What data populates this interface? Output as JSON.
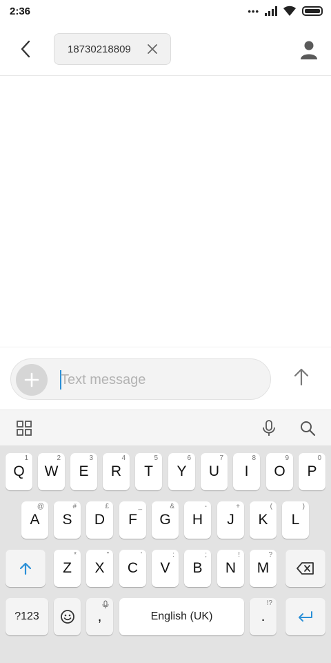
{
  "status": {
    "time": "2:36",
    "dots": "•••"
  },
  "header": {
    "recipient": "18730218809"
  },
  "composer": {
    "placeholder": "Text message"
  },
  "keyboard": {
    "row1": [
      {
        "label": "Q",
        "hint": "1"
      },
      {
        "label": "W",
        "hint": "2"
      },
      {
        "label": "E",
        "hint": "3"
      },
      {
        "label": "R",
        "hint": "4"
      },
      {
        "label": "T",
        "hint": "5"
      },
      {
        "label": "Y",
        "hint": "6"
      },
      {
        "label": "U",
        "hint": "7"
      },
      {
        "label": "I",
        "hint": "8"
      },
      {
        "label": "O",
        "hint": "9"
      },
      {
        "label": "P",
        "hint": "0"
      }
    ],
    "row2": [
      {
        "label": "A",
        "hint": "@"
      },
      {
        "label": "S",
        "hint": "#"
      },
      {
        "label": "D",
        "hint": "£"
      },
      {
        "label": "F",
        "hint": "_"
      },
      {
        "label": "G",
        "hint": "&"
      },
      {
        "label": "H",
        "hint": "-"
      },
      {
        "label": "J",
        "hint": "+"
      },
      {
        "label": "K",
        "hint": "("
      },
      {
        "label": "L",
        "hint": ")"
      }
    ],
    "row3": [
      {
        "label": "Z",
        "hint": "*"
      },
      {
        "label": "X",
        "hint": "\""
      },
      {
        "label": "C",
        "hint": "'"
      },
      {
        "label": "V",
        "hint": ":"
      },
      {
        "label": "B",
        "hint": ";"
      },
      {
        "label": "N",
        "hint": "!"
      },
      {
        "label": "M",
        "hint": "?"
      }
    ],
    "symbols_label": "?123",
    "comma_label": ",",
    "space_label": "English (UK)",
    "period_label": ".",
    "period_hint": "!?"
  },
  "colors": {
    "accent": "#2a8fd7",
    "keyboard_bg": "#e3e3e3"
  }
}
